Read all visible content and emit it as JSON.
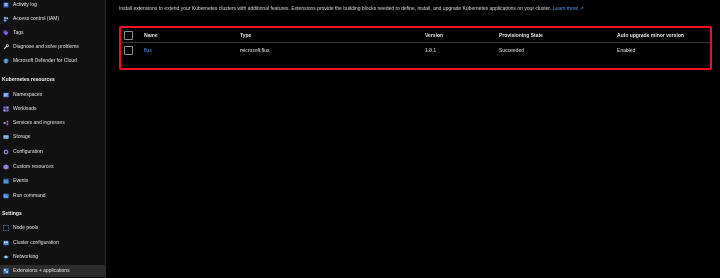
{
  "sidebar": {
    "items_top": [
      {
        "label": "Activity log",
        "icon": "activity-log-icon"
      },
      {
        "label": "Access control (IAM)",
        "icon": "people-icon"
      },
      {
        "label": "Tags",
        "icon": "tag-icon"
      },
      {
        "label": "Diagnose and solve problems",
        "icon": "wrench-icon"
      },
      {
        "label": "Microsoft Defender for Cloud",
        "icon": "shield-icon"
      }
    ],
    "section_kubernetes": "Kubernetes resources",
    "items_kubernetes": [
      {
        "label": "Namespaces",
        "icon": "namespaces-icon"
      },
      {
        "label": "Workloads",
        "icon": "workloads-icon"
      },
      {
        "label": "Services and ingresses",
        "icon": "services-icon"
      },
      {
        "label": "Storage",
        "icon": "storage-icon"
      },
      {
        "label": "Configuration",
        "icon": "configuration-icon"
      },
      {
        "label": "Custom resources",
        "icon": "custom-resources-icon"
      },
      {
        "label": "Events",
        "icon": "events-icon"
      },
      {
        "label": "Run command",
        "icon": "run-command-icon"
      }
    ],
    "section_settings": "Settings",
    "items_settings": [
      {
        "label": "Node pools",
        "icon": "node-pools-icon"
      },
      {
        "label": "Cluster configuration",
        "icon": "cluster-config-icon"
      },
      {
        "label": "Networking",
        "icon": "networking-icon"
      },
      {
        "label": "Extensions + applications",
        "icon": "extensions-icon",
        "selected": true
      }
    ]
  },
  "main": {
    "description": "Install extensions to extend your Kubernetes clusters with additional features. Extensions provide the building blocks needed to define, install, and upgrade Kubernetes applications on your cluster.",
    "learn_more": "Learn more",
    "table": {
      "columns": [
        "Name",
        "Type",
        "Version",
        "Provisioning State",
        "Auto upgrade minor version"
      ],
      "rows": [
        {
          "name": "flux",
          "type": "microsoft.flux",
          "version": "1.8.1",
          "state": "Succeeded",
          "auto_upgrade": "Enabled"
        }
      ]
    }
  },
  "colors": {
    "background": "#000000",
    "sidebar": "#111111",
    "link": "#4aa0ff",
    "highlight_border": "#e81123"
  }
}
